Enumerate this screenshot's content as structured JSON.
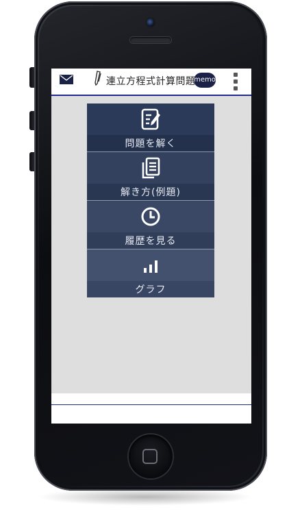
{
  "app": {
    "title": "連立方程式計算問題",
    "memo_label": "memo"
  },
  "menu": {
    "items": [
      {
        "label": "問題を解く",
        "icon": "edit-note-icon",
        "top_color": "#2c3a5a",
        "bottom_color": "#24314d"
      },
      {
        "label": "解き方(例題)",
        "icon": "document-stack-icon",
        "top_color": "#33415f",
        "bottom_color": "#2a3753"
      },
      {
        "label": "履歴を見る",
        "icon": "clock-icon",
        "top_color": "#3a4866",
        "bottom_color": "#313e5a"
      },
      {
        "label": "グラフ",
        "icon": "bar-chart-icon",
        "top_color": "#43516f",
        "bottom_color": "#394663"
      }
    ]
  },
  "colors": {
    "header_underline": "#1e2a8c",
    "content_bg": "#dedede",
    "memo_bg": "#1b2247"
  }
}
